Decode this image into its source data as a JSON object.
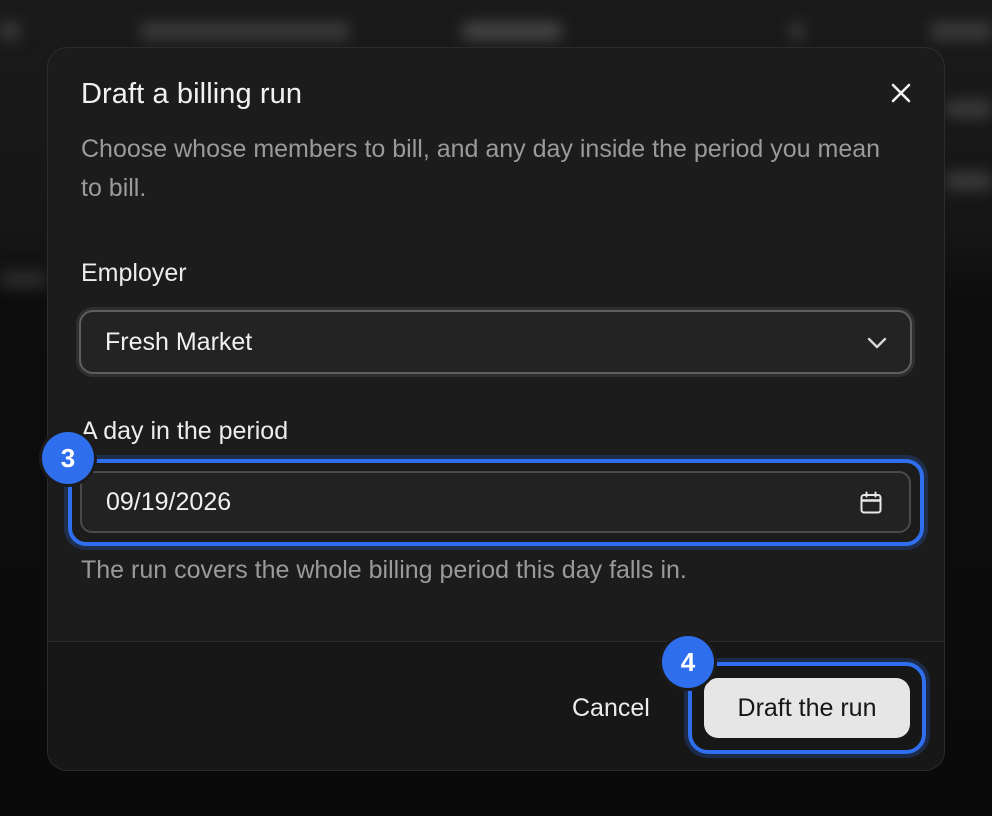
{
  "dialog": {
    "title": "Draft a billing run",
    "description": "Choose whose members to bill, and any day inside the period you mean to bill.",
    "close_icon": "close-icon",
    "employer": {
      "label": "Employer",
      "selected": "Fresh Market",
      "icon": "chevron-down-icon"
    },
    "period_day": {
      "label": "A day in the period",
      "value": "09/19/2026",
      "icon": "calendar-icon",
      "hint": "The run covers the whole billing period this day falls in."
    },
    "actions": {
      "cancel_label": "Cancel",
      "submit_label": "Draft the run"
    }
  },
  "annotations": {
    "date_field_marker": "3",
    "submit_marker": "4",
    "marker_color": "#2f6fee"
  }
}
